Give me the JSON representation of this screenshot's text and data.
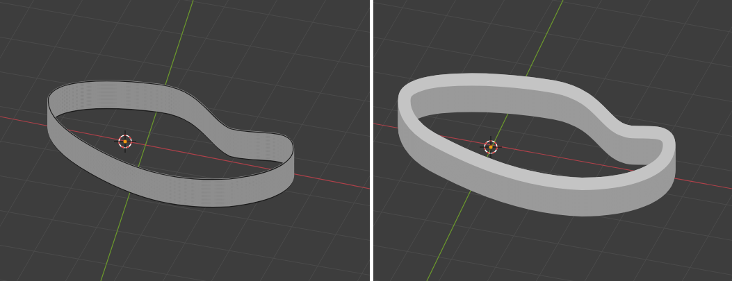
{
  "viewports": [
    {
      "kind": "wireframe"
    },
    {
      "kind": "solid"
    }
  ]
}
